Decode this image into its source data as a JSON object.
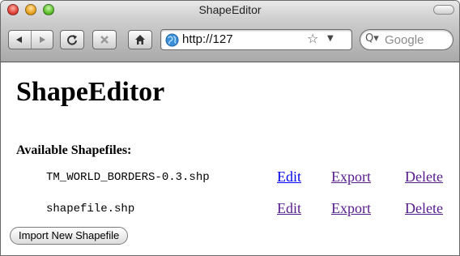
{
  "window": {
    "title": "ShapeEditor"
  },
  "toolbar": {
    "url": "http://127",
    "search_placeholder": "Google",
    "icons": [
      "back-icon",
      "forward-icon",
      "reload-icon",
      "stop-icon",
      "home-icon",
      "globe-icon",
      "star-icon",
      "dropdown-icon",
      "search-icon"
    ]
  },
  "page": {
    "title": "ShapeEditor",
    "section_heading": "Available Shapefiles:",
    "shapefiles": [
      {
        "filename": "TM_WORLD_BORDERS-0.3.shp",
        "edit": "Edit",
        "export": "Export",
        "delete": "Delete"
      },
      {
        "filename": "shapefile.shp",
        "edit": "Edit",
        "export": "Export",
        "delete": "Delete"
      }
    ],
    "import_button": "Import New Shapefile"
  },
  "colors": {
    "link": "#0000ee",
    "visited_link": "#551a8b",
    "close": "#e0443a",
    "minimize": "#e8a220",
    "maximize": "#5ec02e"
  }
}
